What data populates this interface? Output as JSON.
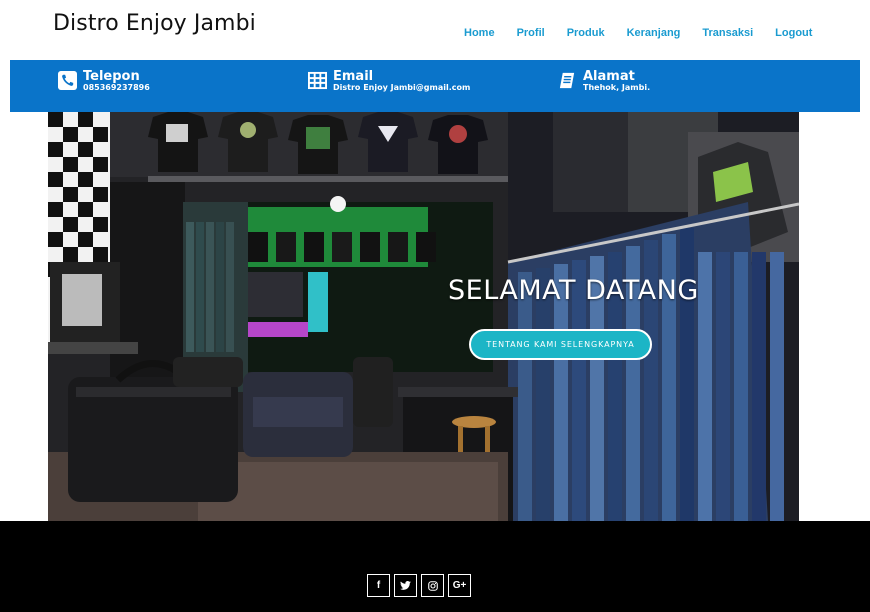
{
  "brand": {
    "title": "Distro Enjoy Jambi"
  },
  "nav": {
    "items": [
      {
        "label": "Home"
      },
      {
        "label": "Profil"
      },
      {
        "label": "Produk"
      },
      {
        "label": "Keranjang"
      },
      {
        "label": "Transaksi"
      },
      {
        "label": "Logout"
      }
    ],
    "color": "#1a9bd0"
  },
  "infobar": {
    "color": "#0a74c9",
    "phone": {
      "icon": "phone-icon",
      "title": "Telepon",
      "value": "085369237896"
    },
    "email": {
      "icon": "grid-table-icon",
      "title": "Email",
      "value": "Distro Enjoy Jambi@gmail.com"
    },
    "address": {
      "icon": "book-icon",
      "title": "Alamat",
      "value": "Thehok, Jambi."
    }
  },
  "hero": {
    "title": "SELAMAT DATANG",
    "button_label": "TENTANG KAMI SELENGKAPNYA",
    "button_color": "#1cb5c6"
  },
  "footer": {
    "social": [
      {
        "icon": "facebook-icon",
        "glyph": "f"
      },
      {
        "icon": "twitter-icon",
        "glyph": "t"
      },
      {
        "icon": "instagram-icon",
        "glyph": "◎"
      },
      {
        "icon": "google-plus-icon",
        "glyph": "G+"
      }
    ]
  }
}
